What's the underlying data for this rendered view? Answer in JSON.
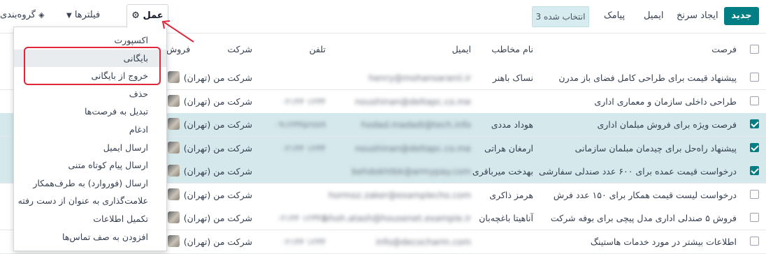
{
  "toolbar": {
    "new_label": "جدید",
    "generate_leads_label": "ایجاد سرنخ",
    "email_label": "ایمیل",
    "sms_label": "پیامک",
    "selected_badge": "3 انتخاب شده",
    "action_label": "عمل",
    "filters_label": "فیلترها",
    "group_by_label": "گروه‌بندی"
  },
  "table": {
    "headers": {
      "opportunity": "فرصت",
      "contact_name": "نام مخاطب",
      "email": "ایمیل",
      "phone": "تلفن",
      "company": "شرکت",
      "salesperson": "فروش"
    },
    "rows": [
      {
        "opportunity": "پیشنهاد قیمت برای طراحی کامل فضای باز مدرن",
        "contact": "نساک باهنر",
        "email": "henry@mohansaranii.ir",
        "phone": "",
        "company": "شرکت من (تهران)",
        "selected": false
      },
      {
        "opportunity": "طراحی داخلی سازمان و معماری اداری",
        "contact": "",
        "email": "noushinan@deltapc.co.me",
        "phone": "۰۲۱۴۴ ۱۲۳۴",
        "company": "شرکت من (تهران)",
        "selected": false
      },
      {
        "opportunity": "فرصت ویژه برای فروش مبلمان اداری",
        "contact": "هوداد مددی",
        "email": "hodad.madadi@tech.info",
        "phone": "۰۹۱۲۳۴۵۶۷۸۹",
        "company": "شرکت من (تهران)",
        "selected": true
      },
      {
        "opportunity": "پیشنهاد راه‌حل برای چیدمان مبلمان سازمانی",
        "contact": "ارمغان هراتی",
        "email": "noushinan@deltapc.co.me",
        "phone": "۰۲۱۴۴ ۱۲۳۴",
        "company": "شرکت من (تهران)",
        "selected": true
      },
      {
        "opportunity": "درخواست قیمت عمده برای ۶۰۰ عدد صندلی سفارشی",
        "contact": "بهدخت میرباقری",
        "email": "behdokhtbk@armypay.com",
        "phone": "",
        "company": "شرکت من (تهران)",
        "selected": true
      },
      {
        "opportunity": "درخواست لیست قیمت همکار برای ۱۵۰ عدد فرش",
        "contact": "هرمز ذاکری",
        "email": "hormoz.zaker@examplecho.com",
        "phone": "",
        "company": "شرکت من (تهران)",
        "selected": false
      },
      {
        "opportunity": "فروش ۵ صندلی اداری مدل پیچی برای بوفه شرکت",
        "contact": "آناهیتا باغچه‌بان",
        "email": "bhoh.atash@housenet.example.ir",
        "phone": "۰۲۱۴۴ ۱۲۳۴۵",
        "company": "شرکت من (تهران)",
        "selected": false
      },
      {
        "opportunity": "اطلاعات بیشتر در مورد خدمات هاستینگ",
        "contact": "",
        "email": "info@decocharm.com",
        "phone": "۰۲۱۴۴ ۱۲۳۴",
        "company": "شرکت من (تهران)",
        "selected": false
      }
    ]
  },
  "action_menu": {
    "items": [
      "اکسپورت",
      "بایگانی",
      "خروج از بایگانی",
      "حذف",
      "تبدیل به فرصت‌ها",
      "ادغام",
      "ارسال ایمیل",
      "ارسال پیام کوتاه متنی",
      "ارسال (فوروارد) به طرف‌همکار",
      "علامت‌گذاری به عنوان از دست رفته",
      "تکمیل اطلاعات",
      "افزودن به صف تماس‌ها"
    ],
    "hovered_index": 1
  },
  "colors": {
    "primary": "#017e84",
    "selected_row": "#d5e9ec",
    "annotation": "#e0273a"
  }
}
